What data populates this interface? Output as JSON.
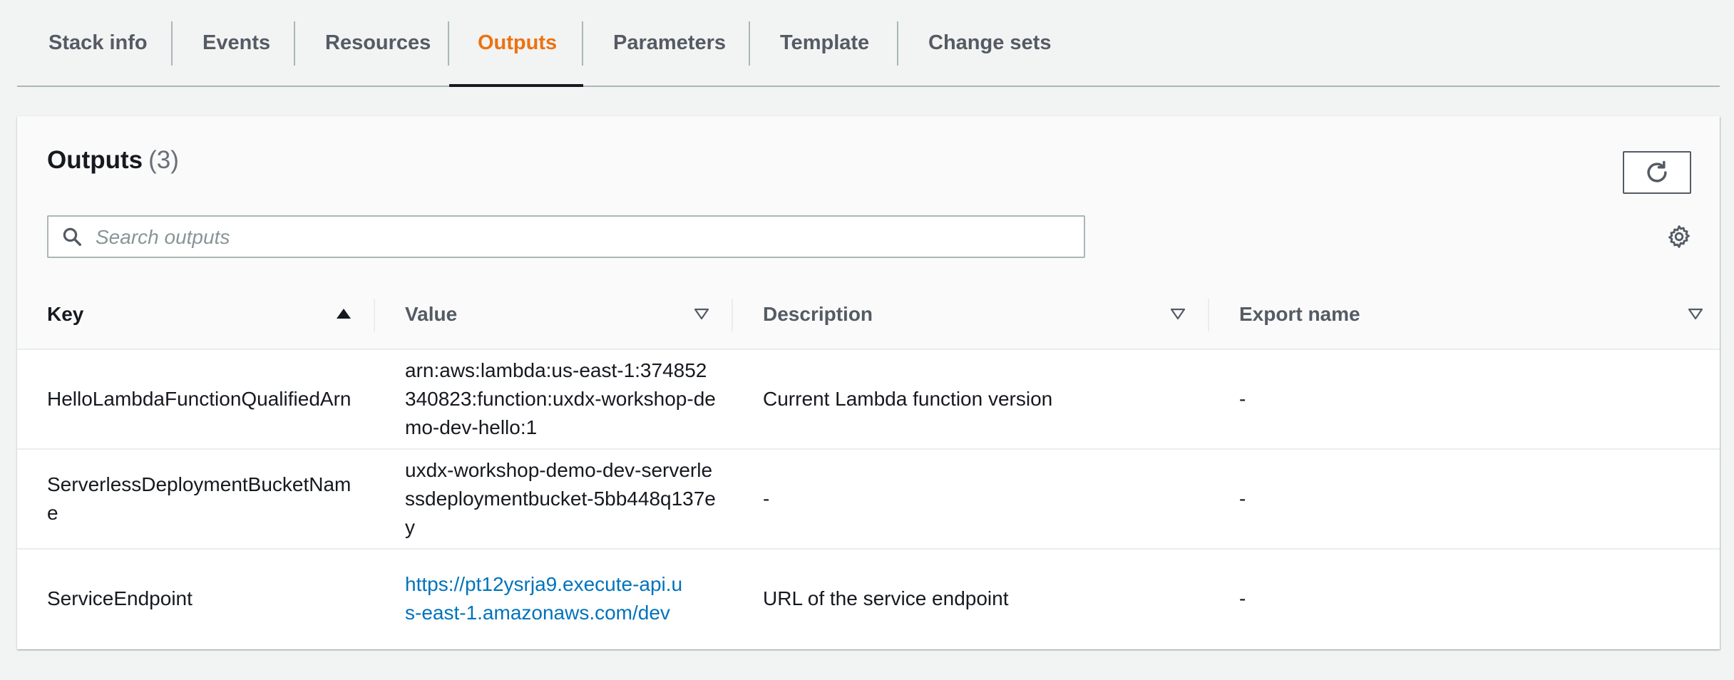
{
  "tabs": [
    {
      "label": "Stack info",
      "active": false
    },
    {
      "label": "Events",
      "active": false
    },
    {
      "label": "Resources",
      "active": false
    },
    {
      "label": "Outputs",
      "active": true
    },
    {
      "label": "Parameters",
      "active": false
    },
    {
      "label": "Template",
      "active": false
    },
    {
      "label": "Change sets",
      "active": false
    }
  ],
  "panel": {
    "title": "Outputs",
    "count": "(3)",
    "refresh_icon": "refresh-icon",
    "settings_icon": "gear-icon",
    "search": {
      "placeholder": "Search outputs",
      "value": "",
      "icon": "search-icon"
    }
  },
  "table": {
    "columns": [
      {
        "label": "Key",
        "sort": "ascending"
      },
      {
        "label": "Value",
        "sort": "sortable"
      },
      {
        "label": "Description",
        "sort": "sortable"
      },
      {
        "label": "Export name",
        "sort": "sortable"
      }
    ],
    "rows": [
      {
        "key": "HelloLambdaFunctionQualifiedArn",
        "value": "arn:aws:lambda:us-east-1:374852340823:function:uxdx-workshop-demo-dev-hello:1",
        "value_is_link": false,
        "description": "Current Lambda function version",
        "export_name": "-"
      },
      {
        "key": "ServerlessDeploymentBucketName",
        "value": "uxdx-workshop-demo-dev-serverlessdeploymentbucket-5bb448q137ey",
        "value_is_link": false,
        "description": "-",
        "export_name": "-"
      },
      {
        "key": "ServiceEndpoint",
        "value": "https://pt12ysrja9.execute-api.us-east-1.amazonaws.com/dev",
        "value_is_link": true,
        "description": "URL of the service endpoint",
        "export_name": "-"
      }
    ]
  },
  "colors": {
    "active_tab": "#ec7211",
    "link": "#0073bb",
    "tab_text": "#545b64"
  }
}
